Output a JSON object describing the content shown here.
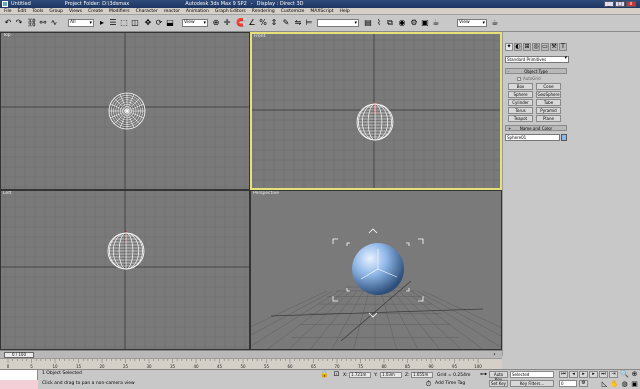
{
  "titlebar": {
    "doc": "Untitled",
    "project": "Project Folder: D:\\3dsmax",
    "app": "Autodesk 3ds Max 9 SP2",
    "display": "Display : Direct 3D",
    "minimize": "_",
    "maximize": "□",
    "close": "x"
  },
  "menu": [
    "File",
    "Edit",
    "Tools",
    "Group",
    "Views",
    "Create",
    "Modifiers",
    "Character",
    "reactor",
    "Animation",
    "Graph Editors",
    "Rendering",
    "Customize",
    "MAXScript",
    "Help"
  ],
  "toolbar": {
    "filter_select": "All",
    "refcoord_select": "View",
    "named_sel_select": "",
    "render_view_select": "View"
  },
  "viewports": {
    "top": "Top",
    "front": "Front",
    "left": "Left",
    "perspective": "Perspective"
  },
  "command_panel": {
    "category": "Standard Primitives",
    "object_type_header": "Object Type",
    "rollout_minus": "-",
    "autogrid": "AutoGrid",
    "buttons": [
      "Box",
      "Cone",
      "Sphere",
      "GeoSphere",
      "Cylinder",
      "Tube",
      "Torus",
      "Pyramid",
      "Teapot",
      "Plane"
    ],
    "name_color_header": "Name and Color",
    "rollout_plus": "+",
    "object_name": "Sphere01",
    "object_color": "#8fb7e8"
  },
  "timeline": {
    "position": "0 / 100",
    "start": 0,
    "end": 100,
    "ticks": [
      0,
      5,
      10,
      15,
      20,
      25,
      30,
      35,
      40,
      45,
      50,
      55,
      60,
      65,
      70,
      75,
      80,
      85,
      90,
      95,
      100
    ]
  },
  "status": {
    "selection": "1 Object Selected",
    "prompt": "Click and drag to pan a non-camera view",
    "x_label": "X:",
    "x_value": "1.721m",
    "y_label": "Y:",
    "y_value": "1.03m",
    "z_label": "Z:",
    "z_value": "1.655m",
    "grid": "Grid = 0.254m",
    "add_time_tag": "Add Time Tag",
    "auto_key": "Auto Key",
    "set_key": "Set Key",
    "key_mode_select": "Selected",
    "key_filters": "Key Filters...",
    "frame": "0"
  },
  "colors": {
    "viewport_bg": "#7a7a7a",
    "grid_line": "#6a6a6a",
    "grid_major": "#3a3a3a",
    "active_border": "#e6e07a",
    "wire": "#ffffff",
    "sphere": "#8fb7e8"
  }
}
